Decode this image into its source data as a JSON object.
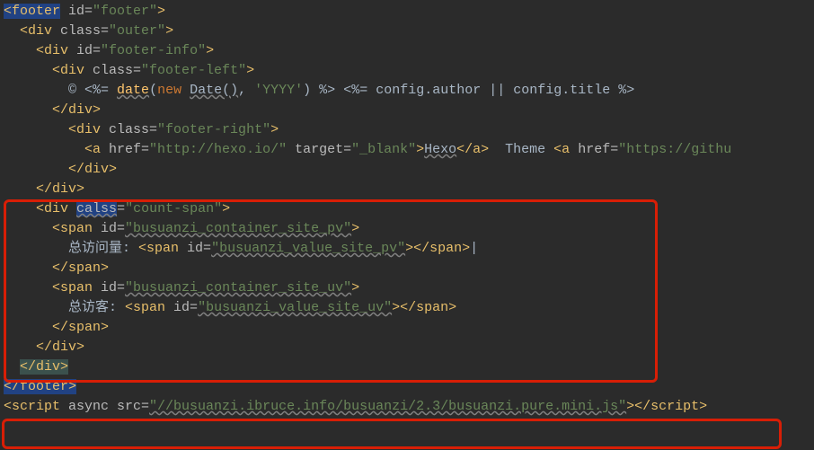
{
  "lines": {
    "l1": {
      "footer_open": "<footer",
      "id_attr": " id=",
      "id_val": "\"footer\"",
      "close": ">"
    },
    "l2": {
      "div_open": "<div",
      "class_attr": " class=",
      "class_val": "\"outer\"",
      "close": ">"
    },
    "l3": {
      "div_open": "<div",
      "id_attr": " id=",
      "id_val": "\"footer-info\"",
      "close": ">"
    },
    "l4": {
      "div_open": "<div",
      "class_attr": " class=",
      "class_val": "\"footer-left\"",
      "close": ">"
    },
    "l5": {
      "copy": "© ",
      "ejs1": "<%= ",
      "date": "date",
      "paren": "(",
      "kw": "new",
      "space": " ",
      "dateC": "Date()",
      "comma": ", ",
      "yyyy": "'YYYY'",
      "paren2": ")",
      "ejs1e": " %>",
      "raw": " <%= config.author || config.title %>"
    },
    "l6": {
      "div_close": "</div>"
    },
    "l7": {
      "div_open": "<div",
      "class_attr": " class=",
      "class_val": "\"footer-right\"",
      "close": ">"
    },
    "l8": {
      "a_open": "<a",
      "href_attr": " href=",
      "href_val": "\"http://hexo.io/\"",
      "target_attr": " target=",
      "target_val": "\"_blank\"",
      "close": ">",
      "hexo": "Hexo",
      "a_close": "</a>",
      "theme": "  Theme ",
      "a2_open": "<a",
      "href2_attr": " href=",
      "href2_val": "\"https://githu"
    },
    "l9": {
      "div_close": "</div>"
    },
    "l10": {
      "div_close": "</div>"
    },
    "l11": {
      "div_open": "<div",
      "calss_attr": " calss=",
      "calss_val": "\"count-span\"",
      "close": ">"
    },
    "l12": {
      "span_open": "<span",
      "id_attr": " id=",
      "id_val": "\"busuanzi_container_site_pv\"",
      "close": ">"
    },
    "l13": {
      "txt": "总访问量: ",
      "span_open": "<span",
      "id_attr": " id=",
      "id_val": "\"busuanzi_value_site_pv\"",
      "close": ">",
      "span_close": "</span>",
      "bar": "|"
    },
    "l14": {
      "span_close": "</span>"
    },
    "l15": {
      "span_open": "<span",
      "id_attr": " id=",
      "id_val": "\"busuanzi_container_site_uv\"",
      "close": ">"
    },
    "l16": {
      "txt": "总访客: ",
      "span_open": "<span",
      "id_attr": " id=",
      "id_val": "\"busuanzi_value_site_uv\"",
      "close": ">",
      "span_close": "</span>"
    },
    "l17": {
      "span_close": "</span>"
    },
    "l18": {
      "div_close": "</div>"
    },
    "l19": {
      "div_close": "</div>"
    },
    "l20": {
      "footer_close": "</footer>"
    },
    "l21": {
      "script_open": "<script",
      "async": " async ",
      "src_attr": "src=",
      "src_val": "\"//busuanzi.ibruce.info/busuanzi/2.3/busuanzi.pure.mini.js\"",
      "close": ">",
      "script_close": "</script>"
    }
  }
}
